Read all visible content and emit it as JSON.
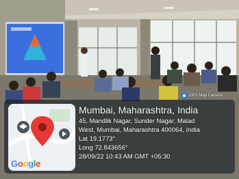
{
  "camera_badge": {
    "label": "GPS Map Camera",
    "icon": "gps-camera-icon"
  },
  "location": {
    "title": "Mumbai, Maharashtra, India",
    "address_line_1": "45, Mandlik Nagar, Sunder Nagar, Malad",
    "address_line_2": "West, Mumbai, Maharashtra 400064, India",
    "latitude": "Lat 19.1773°",
    "longitude": "Long 72.843656°",
    "timestamp": "28/09/22 10:43 AM GMT +05:30"
  },
  "map": {
    "brand_text": "Google",
    "pin_color": "#e53935"
  },
  "colors": {
    "overlay": "#141c24",
    "projection": "#2f63d8"
  }
}
